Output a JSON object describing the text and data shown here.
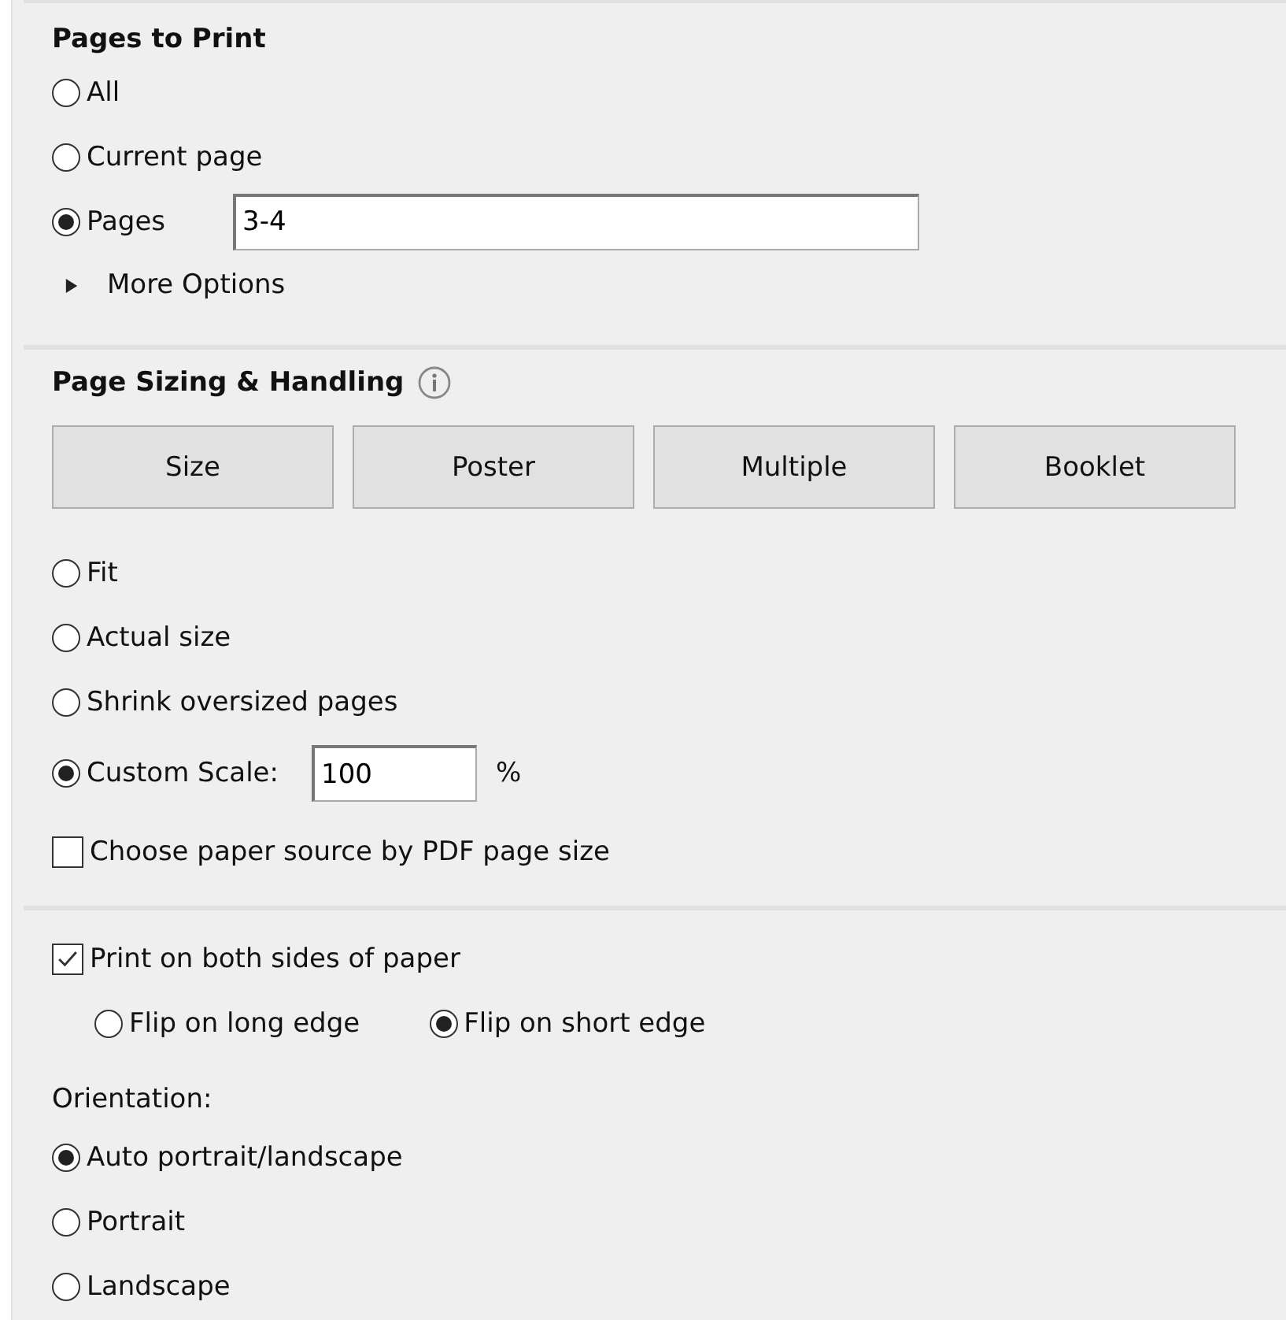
{
  "pages_to_print": {
    "title": "Pages to Print",
    "options": [
      {
        "label": "All",
        "selected": false,
        "kind": "plain"
      },
      {
        "label": "Current page",
        "selected": false,
        "kind": "plain"
      },
      {
        "label": "Pages",
        "selected": true,
        "kind": "field",
        "value": "3-4"
      }
    ],
    "more_options": {
      "label": "More Options",
      "expanded": false
    }
  },
  "page_sizing": {
    "title": "Page Sizing & Handling",
    "buttons": [
      "Size",
      "Poster",
      "Multiple",
      "Booklet"
    ],
    "options": [
      {
        "label": "Fit",
        "selected": false,
        "kind": "plain"
      },
      {
        "label": "Actual size",
        "selected": false,
        "kind": "plain"
      },
      {
        "label": "Shrink oversized pages",
        "selected": false,
        "kind": "plain"
      },
      {
        "label": "Custom Scale:",
        "selected": true,
        "kind": "field",
        "value": "100",
        "unit": "%"
      }
    ],
    "paper_source": {
      "label": "Choose paper source by PDF page size",
      "checked": false
    }
  },
  "duplex": {
    "label": "Print on both sides of paper",
    "checked": true,
    "flips": [
      {
        "label": "Flip on long edge",
        "selected": false
      },
      {
        "label": "Flip on short edge",
        "selected": true
      }
    ]
  },
  "orientation": {
    "label": "Orientation:",
    "options": [
      {
        "label": "Auto portrait/landscape",
        "selected": true
      },
      {
        "label": "Portrait",
        "selected": false
      },
      {
        "label": "Landscape",
        "selected": false
      }
    ]
  }
}
